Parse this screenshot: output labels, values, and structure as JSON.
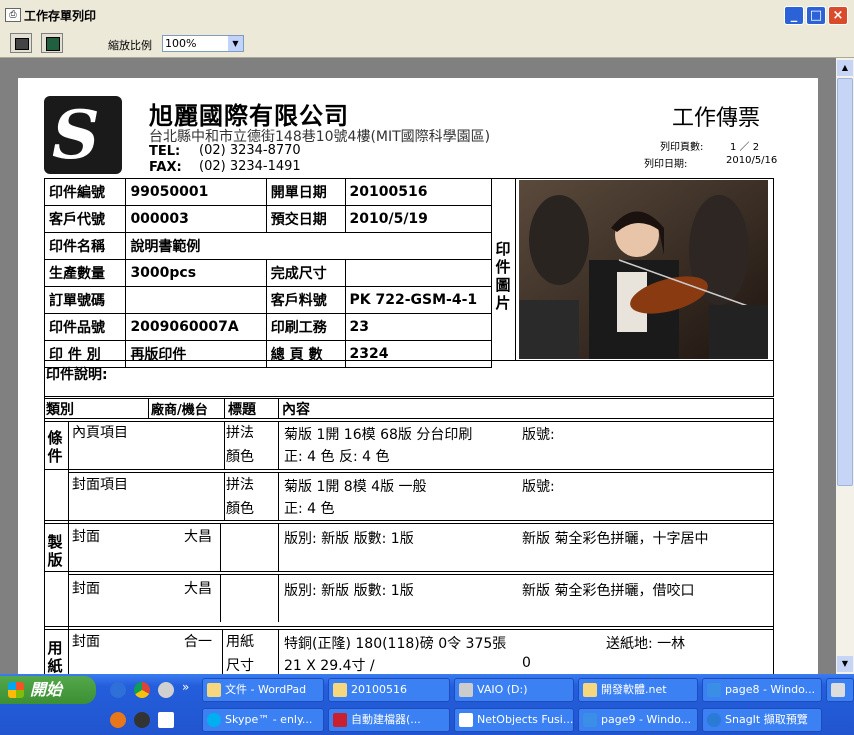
{
  "window": {
    "title": "工作存單列印",
    "min": "_",
    "max": "□",
    "close": "×"
  },
  "toolbar": {
    "zoom_label": "縮放比例",
    "zoom_value": "100%"
  },
  "header": {
    "company": "旭麗國際有限公司",
    "address": "台北縣中和市立德街148巷10號4樓(MIT國際科學園區)",
    "tel_label": "TEL:",
    "tel": "(02) 3234-8770",
    "fax_label": "FAX:",
    "fax": "(02) 3234-1491",
    "doc_title": "工作傳票",
    "page_label": "列印頁數:",
    "page_value": "1  ／  2",
    "date_label": "列印日期:",
    "date_value": "2010/5/16"
  },
  "info": [
    [
      "印件編號",
      "99050001",
      "開單日期",
      "20100516"
    ],
    [
      "客戶代號",
      "000003",
      "預交日期",
      "2010/5/19"
    ],
    [
      "印件名稱",
      "說明書範例",
      "",
      ""
    ],
    [
      "生產數量",
      "3000pcs",
      "完成尺寸",
      ""
    ],
    [
      "訂單號碼",
      "",
      "客戶料號",
      "PK 722-GSM-4-1"
    ],
    [
      "印件品號",
      "2009060007A",
      "印刷工務",
      "23"
    ],
    [
      "印 件 別",
      "再版印件",
      "總 頁 數",
      "2324"
    ]
  ],
  "photo_label": "印件圖片",
  "desc_label": "印件說明:",
  "detail": {
    "headers": [
      "類別",
      "廠商/機台",
      "標題",
      "內容"
    ],
    "section_condition": "條件",
    "section_plate": "製版",
    "section_paper": "用紙",
    "rows": {
      "r1_item": "內頁項目",
      "r1_t1": "拼法",
      "r1_t2": "顏色",
      "r1_c1": "菊版 1開 16模 68版  分台印刷",
      "r1_c1b": "版號:",
      "r1_c2": "正: 4 色 反: 4 色",
      "r2_item": "封面項目",
      "r2_t1": "拼法",
      "r2_t2": "顏色",
      "r2_c1": "菊版 1開 8模 4版  一般",
      "r2_c1b": "版號:",
      "r2_c2": "正: 4 色",
      "r3_item": "封面",
      "r3_vendor": "大昌",
      "r3_c": "版別: 新版  版數: 1版",
      "r3_cb": "新版 菊全彩色拼曬，十字居中",
      "r4_item": "封面",
      "r4_vendor": "大昌",
      "r4_c": "版別: 新版  版數: 1版",
      "r4_cb": "新版 菊全彩色拼曬，借咬口",
      "r5_item": "封面",
      "r5_vendor": "合一",
      "r5_t1": "用紙",
      "r5_t2": "尺寸",
      "r5_c1": "特銅(正隆) 180(118)磅 0令 375張",
      "r5_c1b": "送紙地: 一林",
      "r5_c2": "21 X 29.4寸 /",
      "r5_c2b": "0"
    }
  },
  "taskbar": {
    "start": "開始",
    "row1": [
      "文件 - WordPad",
      "20100516",
      "VAIO (D:)",
      "開發軟體.net",
      "page8 - Windo..."
    ],
    "row2": [
      "Skype™ - enly...",
      "自動建檔器(...",
      "NetObjects Fusi...",
      "page9 - Windo...",
      "SnagIt 擷取預覽"
    ],
    "more": "»"
  }
}
